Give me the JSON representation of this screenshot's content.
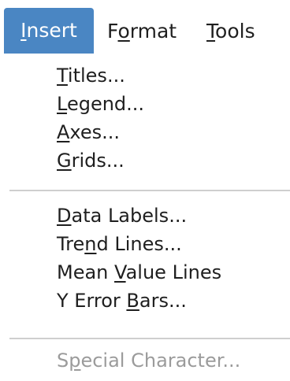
{
  "menubar": {
    "items": [
      {
        "label": "Insert",
        "mnemonic_pre": "",
        "mnemonic": "I",
        "mnemonic_post": "nsert"
      },
      {
        "label": "Format",
        "mnemonic_pre": "F",
        "mnemonic": "o",
        "mnemonic_post": "rmat"
      },
      {
        "label": "Tools",
        "mnemonic_pre": "",
        "mnemonic": "T",
        "mnemonic_post": "ools"
      }
    ]
  },
  "dropdown": {
    "groups": [
      [
        {
          "pre": "",
          "m": "T",
          "post": "itles..."
        },
        {
          "pre": "",
          "m": "L",
          "post": "egend..."
        },
        {
          "pre": "",
          "m": "A",
          "post": "xes..."
        },
        {
          "pre": "",
          "m": "G",
          "post": "rids..."
        }
      ],
      [
        {
          "pre": "",
          "m": "D",
          "post": "ata Labels..."
        },
        {
          "pre": "Tre",
          "m": "n",
          "post": "d Lines..."
        },
        {
          "pre": "Mean ",
          "m": "V",
          "post": "alue Lines"
        },
        {
          "pre": "Y Error ",
          "m": "B",
          "post": "ars..."
        }
      ],
      [
        {
          "pre": "S",
          "m": "p",
          "post": "ecial Character...",
          "disabled": true
        }
      ]
    ]
  }
}
